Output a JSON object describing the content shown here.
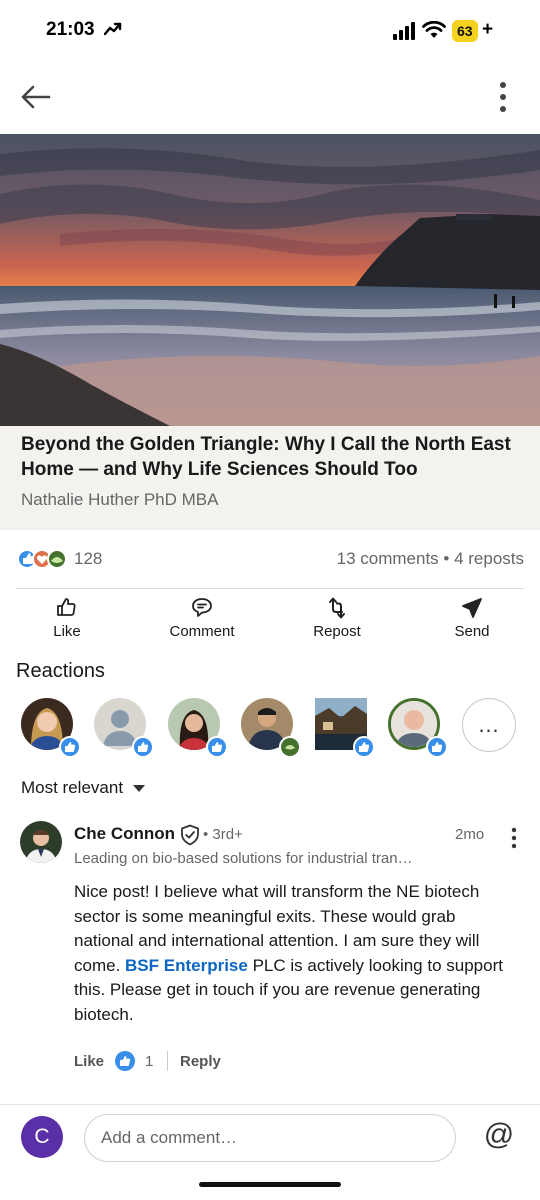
{
  "status_bar": {
    "time": "21:03",
    "battery": "63",
    "charging_symbol": "+"
  },
  "article": {
    "title": "Beyond the Golden Triangle: Why I Call the North East Home — and Why Life Sciences Should Too",
    "author": "Nathalie Huther PhD MBA"
  },
  "social": {
    "reaction_count": "128",
    "comments_reposts": "13 comments • 4 reposts"
  },
  "actions": {
    "like": "Like",
    "comment": "Comment",
    "repost": "Repost",
    "send": "Send"
  },
  "reactions": {
    "heading": "Reactions",
    "reactors": [
      {
        "type": "like"
      },
      {
        "type": "like"
      },
      {
        "type": "like"
      },
      {
        "type": "support"
      },
      {
        "type": "like"
      },
      {
        "type": "like"
      }
    ],
    "more_label": "…"
  },
  "sort": {
    "selected": "Most relevant"
  },
  "comment": {
    "author": "Che Connon",
    "degree": "• 3rd+",
    "time": "2mo",
    "headline": "Leading on bio-based solutions for industrial transformation",
    "body_pre": "Nice post! I believe what will transform the NE biotech sector is some meaningful exits. These would grab national and international attention. I am sure they will come. ",
    "mention": "BSF Enterprise",
    "body_post": " PLC is actively looking to support this. Please get in touch if you are revenue generating biotech.",
    "like_label": "Like",
    "like_count": "1",
    "reply_label": "Reply"
  },
  "composer": {
    "user_initial": "C",
    "placeholder": "Add a comment…",
    "mention_symbol": "@"
  },
  "colors": {
    "linkedin_blue": "#0a66c2",
    "like_blue": "#378fe9",
    "user_avatar": "#5b2fa8",
    "battery": "#f5d21e"
  }
}
